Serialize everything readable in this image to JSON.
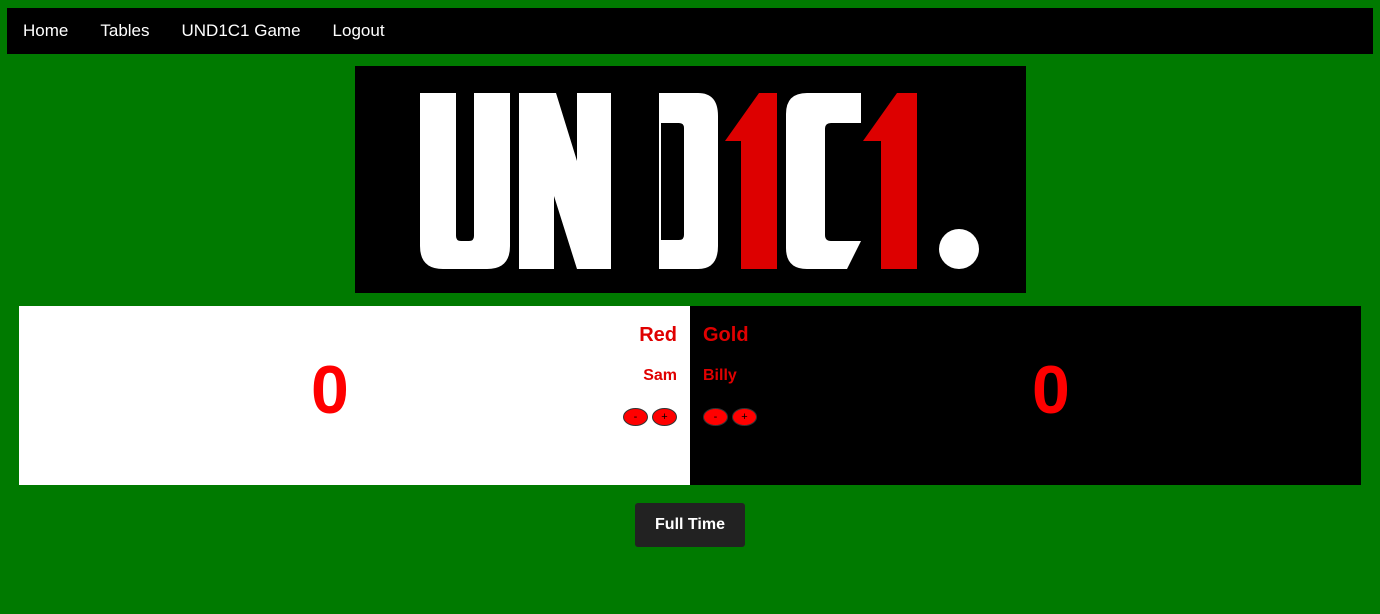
{
  "nav": {
    "items": [
      {
        "label": "Home"
      },
      {
        "label": "Tables"
      },
      {
        "label": "UND1C1 Game"
      },
      {
        "label": "Logout"
      }
    ]
  },
  "logo": {
    "text_parts": [
      "UND",
      "1",
      "C",
      "1",
      "."
    ],
    "colors": {
      "white": "#ffffff",
      "red": "#dd0000",
      "background": "#000000"
    }
  },
  "teams": {
    "left": {
      "name": "Red",
      "player": "Sam",
      "score": "0",
      "minus_label": "-",
      "plus_label": "+",
      "panel_color": "#ffffff"
    },
    "right": {
      "name": "Gold",
      "player": "Billy",
      "score": "0",
      "minus_label": "-",
      "plus_label": "+",
      "panel_color": "#000000"
    }
  },
  "actions": {
    "full_time_label": "Full Time"
  },
  "colors": {
    "page_background": "#007a00",
    "accent_red": "#ff0000"
  }
}
